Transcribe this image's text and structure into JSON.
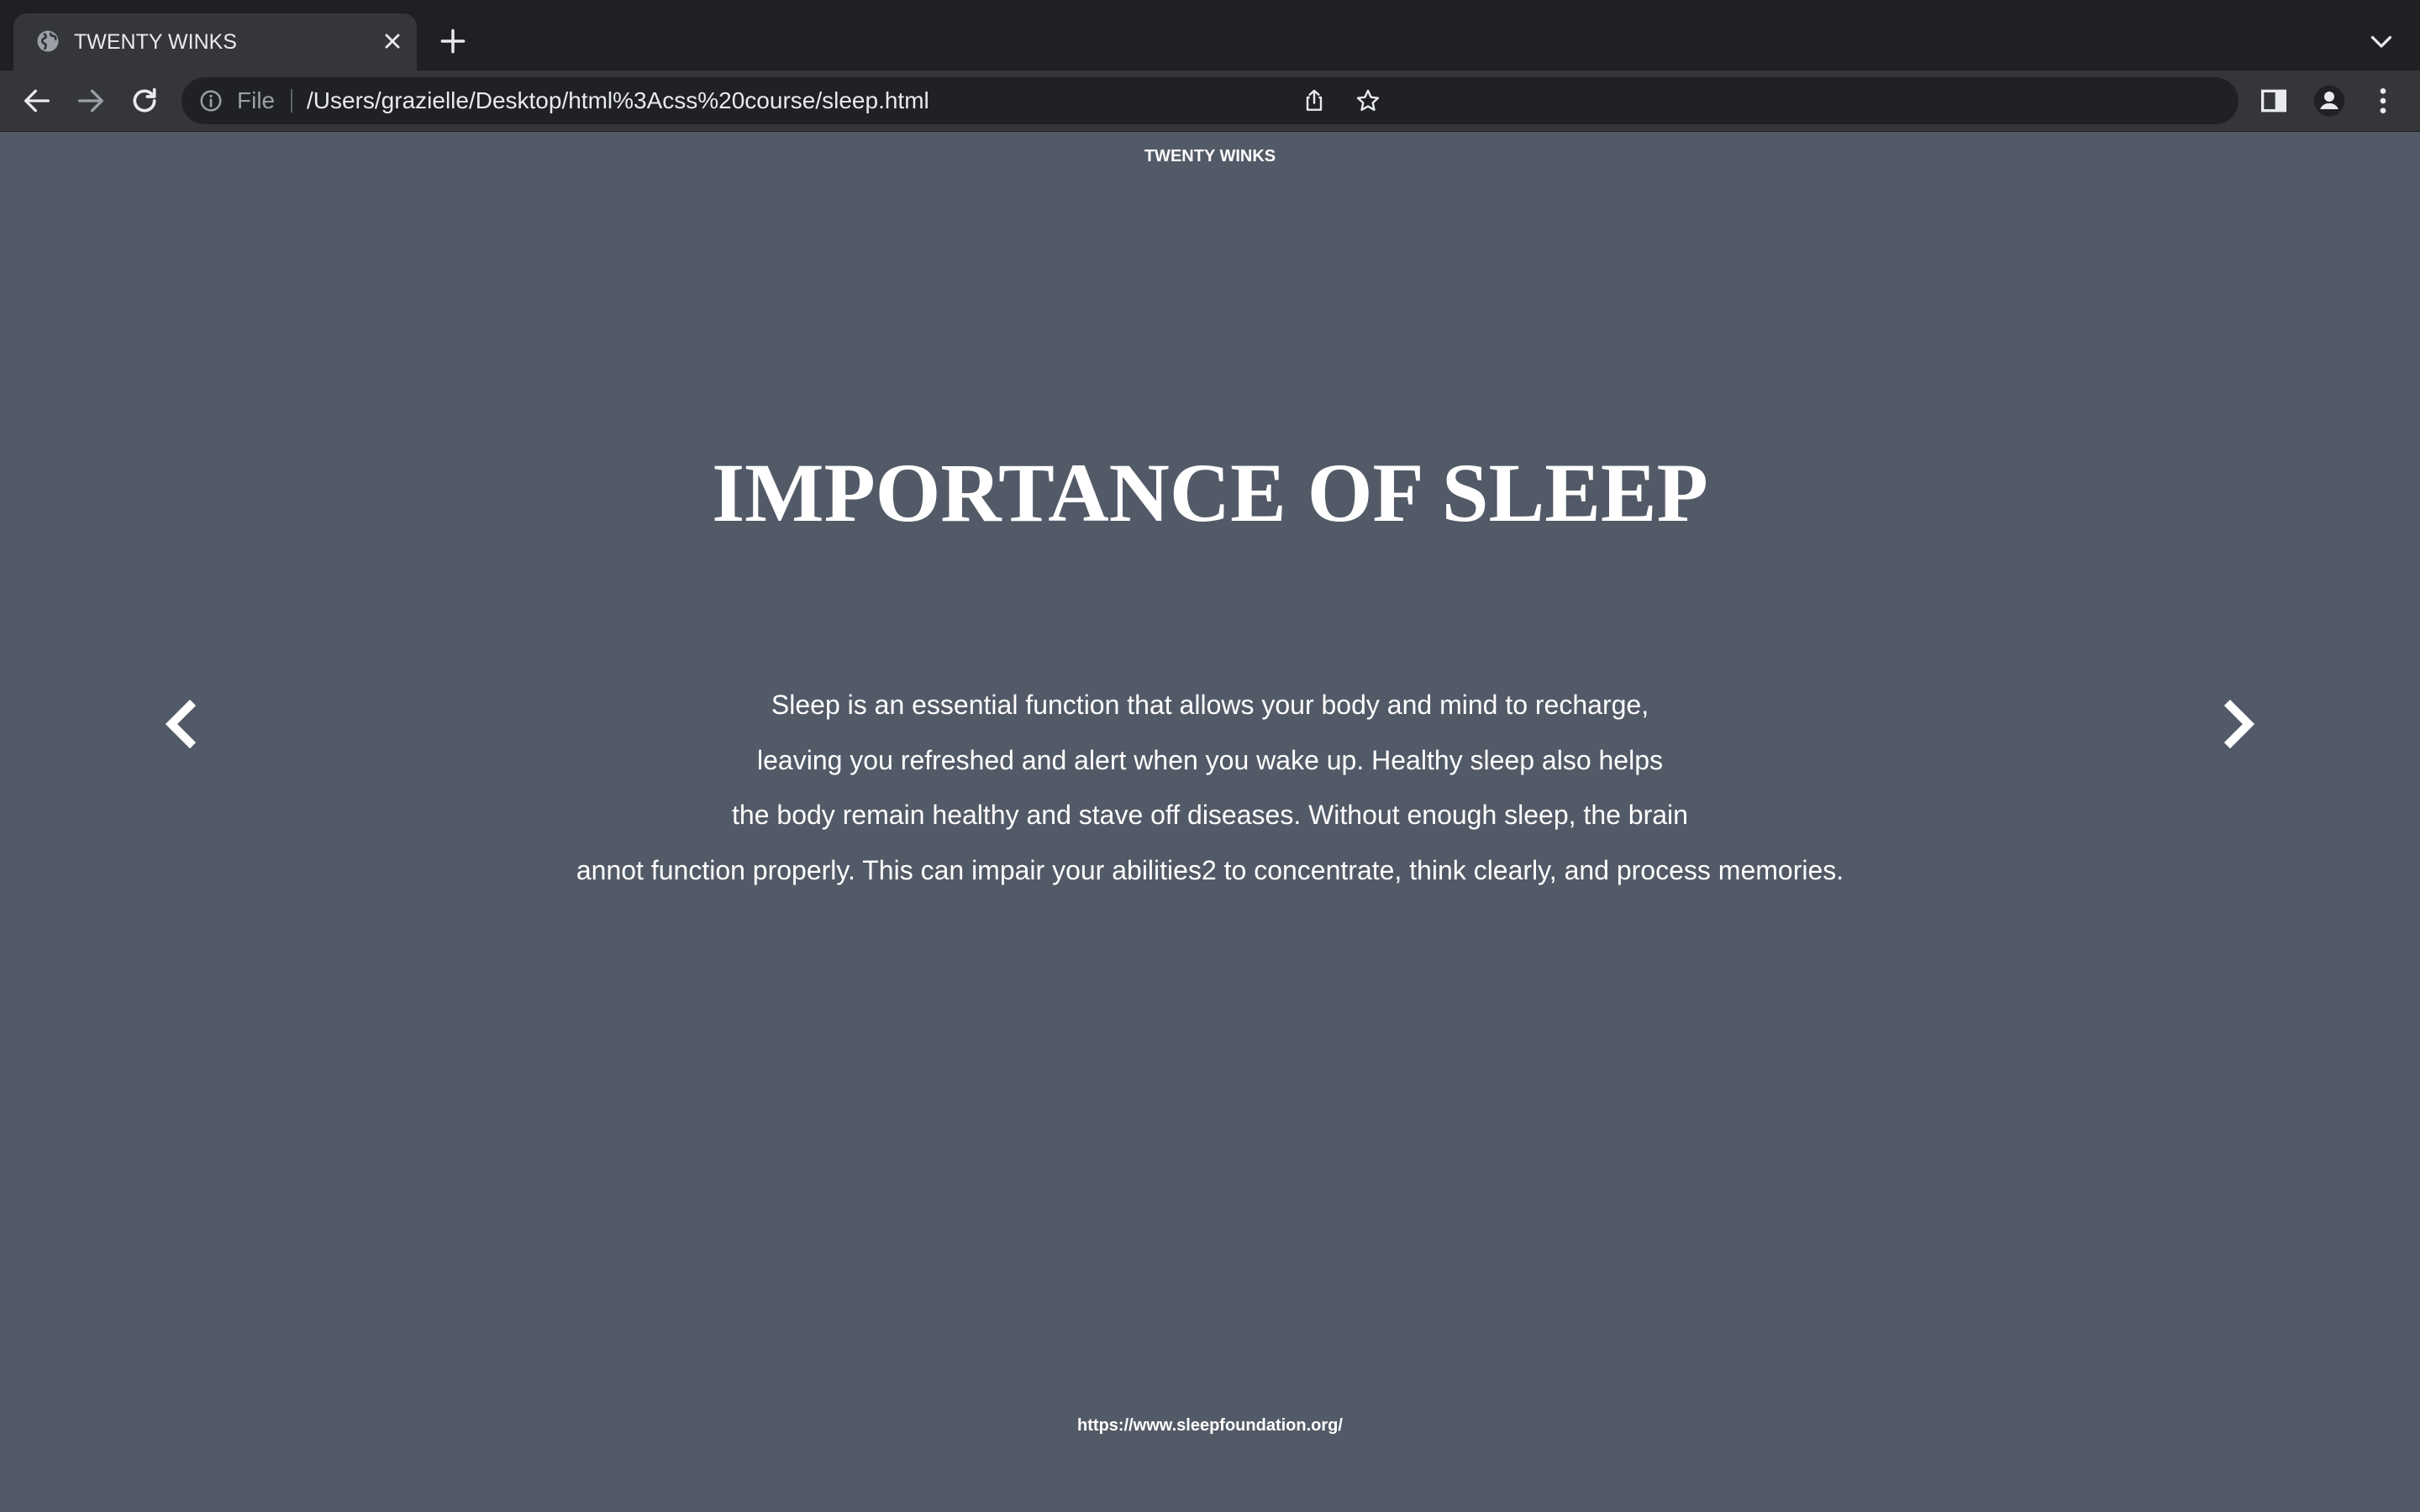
{
  "browser": {
    "tab": {
      "title": "TWENTY WINKS",
      "favicon_icon": "globe-icon",
      "close_icon": "close-icon"
    },
    "new_tab_icon": "plus-icon",
    "tab_search_icon": "chevron-down-icon",
    "toolbar": {
      "back_icon": "arrow-left-icon",
      "forward_icon": "arrow-right-icon",
      "reload_icon": "reload-icon",
      "site_info_icon": "info-icon",
      "scheme_label": "File",
      "url": "/Users/grazielle/Desktop/html%3Acss%20course/sleep.html",
      "share_icon": "share-icon",
      "bookmark_icon": "star-icon",
      "side_panel_icon": "side-panel-icon",
      "profile_icon": "person-icon",
      "menu_icon": "kebab-menu-icon"
    }
  },
  "page": {
    "site_title": "TWENTY WINKS",
    "heading": "IMPORTANCE OF SLEEP",
    "paragraph_lines": [
      "Sleep is an essential function that allows your body and mind to recharge,",
      "leaving you refreshed and alert when you wake up. Healthy sleep also helps",
      "the body remain healthy and stave off diseases. Without enough sleep, the brain",
      "annot function properly. This can impair your abilities2 to concentrate, think clearly, and process memories."
    ],
    "prev_arrow_icon": "chevron-left-icon",
    "next_arrow_icon": "chevron-right-icon",
    "source_link": "https://www.sleepfoundation.org/"
  },
  "colors": {
    "page_background": "#535a67",
    "text": "#ffffff",
    "tabbar_background": "#1f2023",
    "toolbar_background": "#35363a",
    "omnibox_background": "#202124"
  }
}
